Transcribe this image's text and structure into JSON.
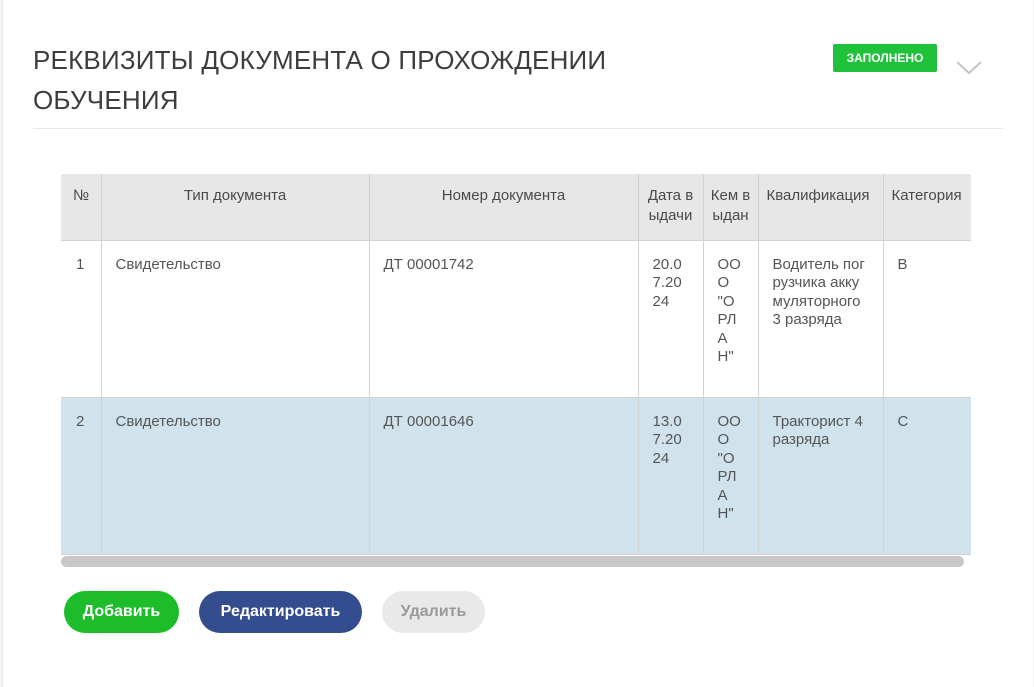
{
  "section": {
    "title": "РЕКВИЗИТЫ ДОКУМЕНТА О ПРОХОЖДЕНИИ ОБУЧЕНИЯ",
    "status": "ЗАПОЛНЕНО",
    "status_color": "#1fc13b",
    "collapse_icon": "chevron-down-icon"
  },
  "table": {
    "columns": [
      "№",
      "Тип документа",
      "Номер документа",
      "Дата выдачи",
      "Кем выдан",
      "Квалификация",
      "Категория"
    ],
    "rows": [
      {
        "num": "1",
        "type": "Свидетельство",
        "number": "ДТ 00001742",
        "date": "20.07.2024",
        "issuer": "ООО \"ОРЛАН\"",
        "qualification": "Водитель погрузчика аккумуляторного 3 разряда",
        "category": "B"
      },
      {
        "num": "2",
        "type": "Свидетельство",
        "number": "ДТ 00001646",
        "date": "13.07.2024",
        "issuer": "ООО \"ОРЛАН\"",
        "qualification": "Тракторист 4 разряда",
        "category": "C"
      }
    ],
    "selected_row_color": "#d0e3ec"
  },
  "actions": {
    "add": "Добавить",
    "edit": "Редактировать",
    "delete": "Удалить"
  }
}
